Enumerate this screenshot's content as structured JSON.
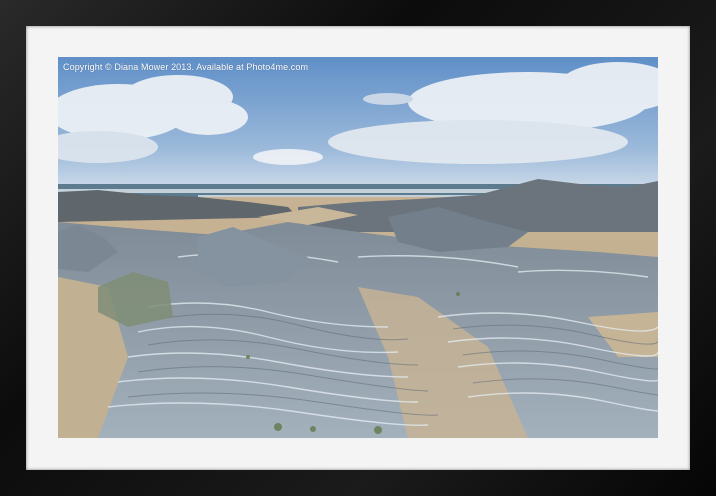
{
  "watermark": {
    "text": "Copyright © Diana Mower 2013. Available at Photo4me.com"
  },
  "colors": {
    "frame": "#111111",
    "mat": "#f4f4f4",
    "sky_top": "#5f8fc8",
    "sky_bottom": "#c9d8e8",
    "sea": "#5d7b8f",
    "rock": "#8e9aa6",
    "sand": "#c9b79a"
  }
}
